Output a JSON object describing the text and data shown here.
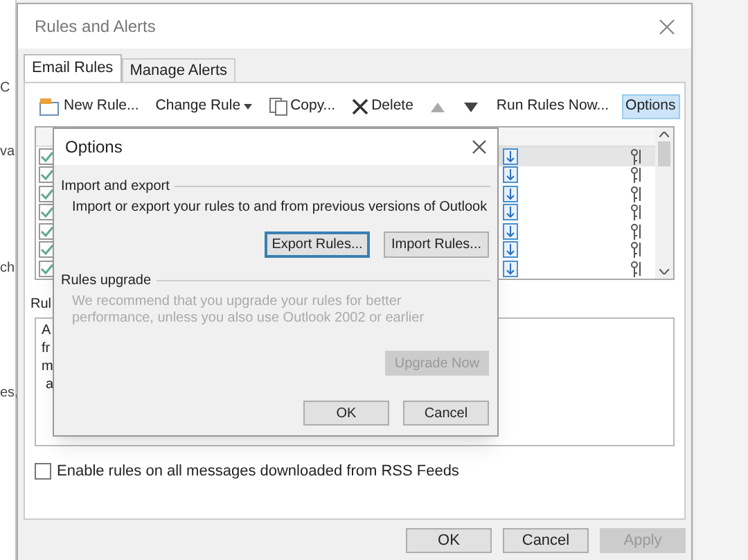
{
  "background_fragments": [
    "C",
    "va",
    "ch",
    "es,"
  ],
  "window": {
    "title": "Rules and Alerts"
  },
  "tabs": [
    {
      "label": "Email Rules",
      "selected": true
    },
    {
      "label": "Manage Alerts",
      "selected": false
    }
  ],
  "toolbar": [
    {
      "kind": "new",
      "label": "New Rule...",
      "highlighted": false
    },
    {
      "kind": "change",
      "label": "Change Rule",
      "highlighted": false
    },
    {
      "kind": "copy",
      "label": "Copy...",
      "highlighted": false
    },
    {
      "kind": "delete",
      "label": "Delete",
      "highlighted": false
    },
    {
      "kind": "up",
      "highlighted": false
    },
    {
      "kind": "down",
      "highlighted": false
    },
    {
      "kind": "run",
      "label": "Run Rules Now...",
      "highlighted": false
    },
    {
      "kind": "options",
      "label": "Options",
      "highlighted": true
    }
  ],
  "rules": [
    {
      "checked": true,
      "selected": true
    },
    {
      "checked": true,
      "selected": false
    },
    {
      "checked": true,
      "selected": false
    },
    {
      "checked": true,
      "selected": false
    },
    {
      "checked": true,
      "selected": false
    },
    {
      "checked": true,
      "selected": false
    },
    {
      "checked": true,
      "selected": false
    }
  ],
  "rule_description": {
    "label": "Rul",
    "lines": [
      "A",
      "fr",
      "m",
      "a"
    ]
  },
  "rss_option": {
    "label": "Enable rules on all messages downloaded from RSS Feeds",
    "checked": false
  },
  "buttons": [
    {
      "label": "OK",
      "disabled": false
    },
    {
      "label": "Cancel",
      "disabled": false
    },
    {
      "label": "Apply",
      "disabled": true
    }
  ],
  "options_dialog": {
    "title": "Options",
    "import_export": {
      "heading": "Import and export",
      "text": "Import or export your rules to and from previous versions of Outlook",
      "buttons": [
        {
          "label": "Export Rules...",
          "focused": true
        },
        {
          "label": "Import Rules...",
          "focused": false
        }
      ]
    },
    "upgrade": {
      "heading": "Rules upgrade",
      "text": "We recommend that you upgrade your rules for better performance, unless you also use Outlook 2002 or earlier",
      "button": {
        "label": "Upgrade Now",
        "disabled": true
      }
    },
    "buttons": [
      {
        "label": "OK",
        "disabled": false
      },
      {
        "label": "Cancel",
        "disabled": false
      }
    ]
  }
}
